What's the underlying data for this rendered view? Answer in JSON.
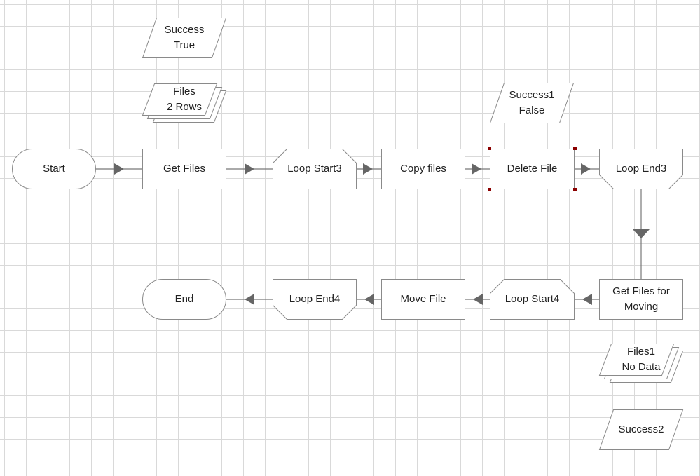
{
  "nodes": {
    "start": {
      "label": "Start"
    },
    "get_files": {
      "label": "Get Files"
    },
    "loop_start3": {
      "label": "Loop Start3"
    },
    "copy_files": {
      "label": "Copy files"
    },
    "delete_file": {
      "label": "Delete File"
    },
    "loop_end3": {
      "label": "Loop End3"
    },
    "get_files_moving": {
      "line1": "Get Files for",
      "line2": "Moving"
    },
    "loop_start4": {
      "label": "Loop Start4"
    },
    "move_file": {
      "label": "Move File"
    },
    "loop_end4": {
      "label": "Loop End4"
    },
    "end": {
      "label": "End"
    }
  },
  "data_objects": {
    "success": {
      "line1": "Success",
      "line2": "True"
    },
    "files": {
      "line1": "Files",
      "line2": "2 Rows"
    },
    "success1": {
      "line1": "Success1",
      "line2": "False"
    },
    "files1": {
      "line1": "Files1",
      "line2": "No Data"
    },
    "success2": {
      "line1": "Success2"
    }
  },
  "selected_node": "delete_file",
  "colors": {
    "grid": "#d9d9d9",
    "stroke": "#8a8a8a",
    "arrow": "#666666",
    "selection_handle": "#8b0000"
  }
}
